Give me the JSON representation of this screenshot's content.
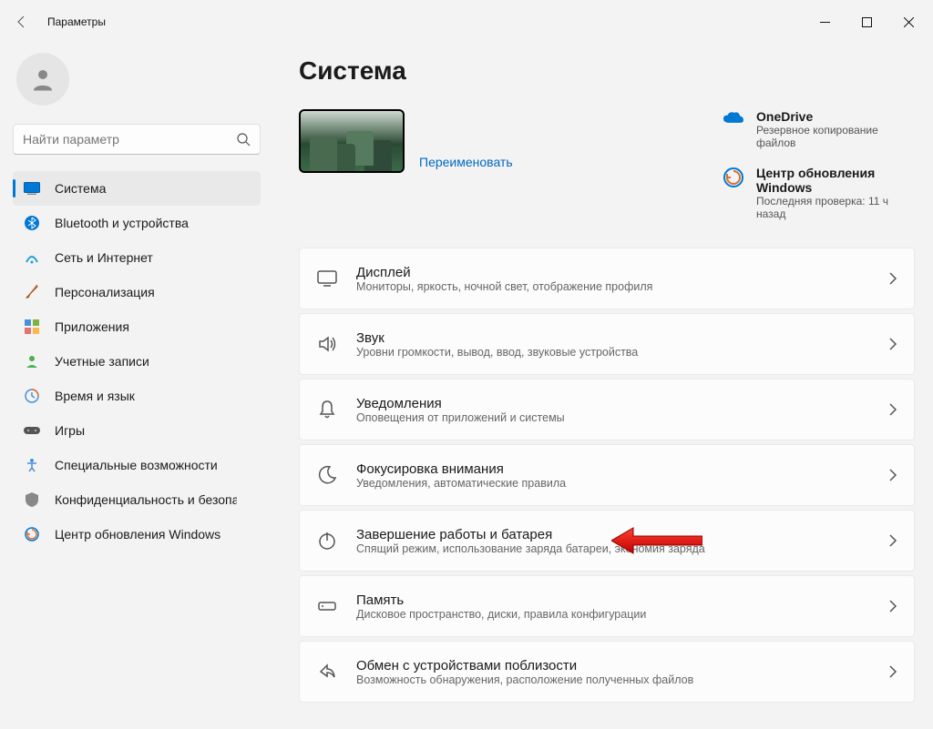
{
  "window": {
    "title": "Параметры"
  },
  "search": {
    "placeholder": "Найти параметр"
  },
  "sidebar": {
    "items": [
      {
        "label": "Система"
      },
      {
        "label": "Bluetooth и устройства"
      },
      {
        "label": "Сеть и Интернет"
      },
      {
        "label": "Персонализация"
      },
      {
        "label": "Приложения"
      },
      {
        "label": "Учетные записи"
      },
      {
        "label": "Время и язык"
      },
      {
        "label": "Игры"
      },
      {
        "label": "Специальные возможности"
      },
      {
        "label": "Конфиденциальность и безопасность"
      },
      {
        "label": "Центр обновления Windows"
      }
    ]
  },
  "page": {
    "title": "Система"
  },
  "device": {
    "rename": "Переименовать"
  },
  "info": {
    "onedrive": {
      "title": "OneDrive",
      "sub": "Резервное копирование файлов"
    },
    "update": {
      "title": "Центр обновления Windows",
      "sub": "Последняя проверка: 11 ч назад"
    }
  },
  "settings": [
    {
      "title": "Дисплей",
      "sub": "Мониторы, яркость, ночной свет, отображение профиля"
    },
    {
      "title": "Звук",
      "sub": "Уровни громкости, вывод, ввод, звуковые устройства"
    },
    {
      "title": "Уведомления",
      "sub": "Оповещения от приложений и системы"
    },
    {
      "title": "Фокусировка внимания",
      "sub": "Уведомления, автоматические правила"
    },
    {
      "title": "Завершение работы и батарея",
      "sub": "Спящий режим, использование заряда батареи, экономия заряда"
    },
    {
      "title": "Память",
      "sub": "Дисковое пространство, диски, правила конфигурации"
    },
    {
      "title": "Обмен с устройствами поблизости",
      "sub": "Возможность обнаружения, расположение полученных файлов"
    }
  ]
}
